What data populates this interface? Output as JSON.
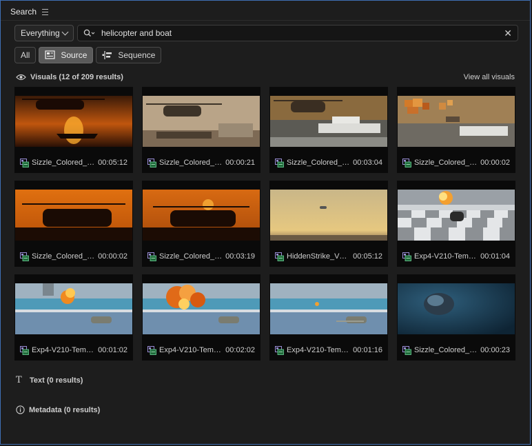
{
  "panel": {
    "title": "Search"
  },
  "scope": {
    "selected": "Everything"
  },
  "search": {
    "query": "helicopter and boat"
  },
  "filters": [
    {
      "label": "All",
      "active": false
    },
    {
      "label": "Source",
      "active": true
    },
    {
      "label": "Sequence",
      "active": false
    }
  ],
  "visuals": {
    "title": "Visuals (12 of 209 results)",
    "view_all": "View all visuals",
    "items": [
      {
        "name": "Sizzle_Colored_…",
        "timecode": "00:05:12",
        "scene": "sunset-heli-boat"
      },
      {
        "name": "Sizzle_Colored_…",
        "timecode": "00:00:21",
        "scene": "haze-heli-ship"
      },
      {
        "name": "Sizzle_Colored_…",
        "timecode": "00:03:04",
        "scene": "heli-over-yacht"
      },
      {
        "name": "Sizzle_Colored_…",
        "timecode": "00:00:02",
        "scene": "pixel-explosion-boat"
      },
      {
        "name": "Sizzle_Colored_…",
        "timecode": "00:00:02",
        "scene": "chinook-sunset"
      },
      {
        "name": "Sizzle_Colored_…",
        "timecode": "00:03:19",
        "scene": "chinook-sunset-2"
      },
      {
        "name": "HiddenStrike_V…",
        "timecode": "00:05:12",
        "scene": "desert-sky-heli"
      },
      {
        "name": "Exp4-V210-Tem…",
        "timecode": "00:01:04",
        "scene": "checker-explosion"
      },
      {
        "name": "Exp4-V210-Tem…",
        "timecode": "00:01:02",
        "scene": "ship-explosion"
      },
      {
        "name": "Exp4-V210-Tem…",
        "timecode": "00:02:02",
        "scene": "ship-big-explosion"
      },
      {
        "name": "Exp4-V210-Tem…",
        "timecode": "00:01:16",
        "scene": "ship-heli"
      },
      {
        "name": "Sizzle_Colored_…",
        "timecode": "00:00:23",
        "scene": "underwater-heli"
      }
    ]
  },
  "text_section": {
    "title": "Text (0 results)"
  },
  "metadata_section": {
    "title": "Metadata (0 results)"
  },
  "colors": {
    "accent_border": "#3f6fb4",
    "active_filter": "#5a5a5a",
    "clip_icon": "#9b8fd8"
  },
  "icons": [
    "hamburger-icon",
    "chevron-down-icon",
    "search-icon",
    "close-icon",
    "source-icon",
    "sequence-icon",
    "eye-icon",
    "text-icon",
    "info-icon",
    "clip-icon"
  ]
}
